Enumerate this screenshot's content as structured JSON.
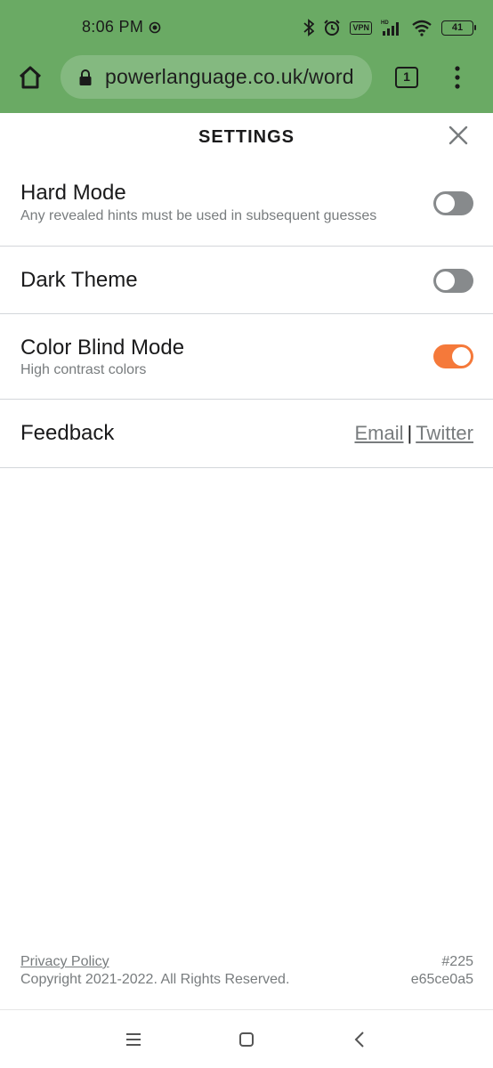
{
  "status_bar": {
    "time": "8:06 PM",
    "vpn": "VPN",
    "battery": "41"
  },
  "browser": {
    "url": "powerlanguage.co.uk/word",
    "tab_count": "1"
  },
  "settings": {
    "title": "SETTINGS",
    "rows": [
      {
        "label": "Hard Mode",
        "description": "Any revealed hints must be used in subsequent guesses",
        "enabled": false
      },
      {
        "label": "Dark Theme",
        "enabled": false
      },
      {
        "label": "Color Blind Mode",
        "description": "High contrast colors",
        "enabled": true
      }
    ],
    "feedback": {
      "label": "Feedback",
      "email": "Email",
      "separator": "|",
      "twitter": "Twitter"
    }
  },
  "footer": {
    "privacy": "Privacy Policy",
    "copyright": "Copyright 2021-2022. All Rights Reserved.",
    "puzzle_number": "#225",
    "hash": "e65ce0a5"
  },
  "colors": {
    "header_green": "#6aaa64",
    "toggle_on": "#f5793a",
    "toggle_off": "#878a8c"
  }
}
